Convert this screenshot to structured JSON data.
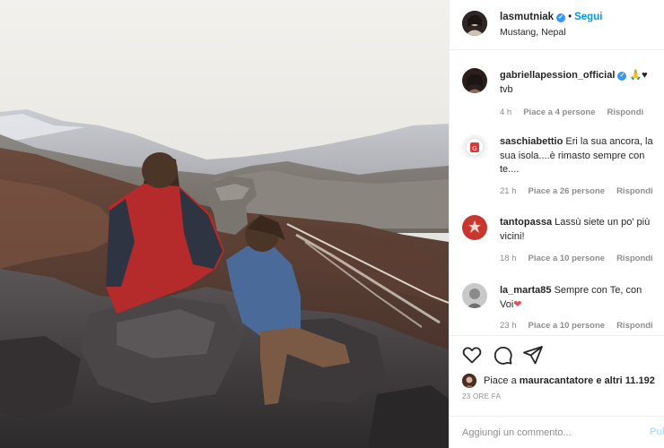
{
  "post": {
    "photo_icon": "photo",
    "header": {
      "username": "lasmutniak",
      "verified_icon": "verified-badge-icon",
      "separator": "•",
      "follow_label": "Segui",
      "location": "Mustang, Nepal"
    },
    "comments": [
      {
        "username": "gabriellapession_official",
        "verified": true,
        "emoji": "🙏♥",
        "text": "tvb",
        "time": "4 h",
        "likes": "Piace a 4 persone",
        "reply_label": "Rispondi",
        "avatar_color": "#2a1f1c"
      },
      {
        "username": "saschiabettio",
        "text": "Eri la sua ancora, la sua isola....è rimasto sempre con te....",
        "time": "21 h",
        "likes": "Piace a 26 persone",
        "reply_label": "Rispondi",
        "avatar_color": "#d93a3a"
      },
      {
        "username": "tantopassa",
        "text": "Lassù siete un po' più vicini!",
        "time": "18 h",
        "likes": "Piace a 10 persone",
        "reply_label": "Rispondi",
        "avatar_color": "#c8372d"
      },
      {
        "username": "la_marta85",
        "text": "Sempre con Te, con Voi",
        "heart": "❤",
        "time": "23 h",
        "likes": "Piace a 10 persone",
        "reply_label": "Rispondi",
        "avatar_color": "#8a8a8a"
      }
    ],
    "actions": {
      "like_icon": "heart-icon",
      "comment_icon": "comment-icon",
      "share_icon": "share-icon"
    },
    "likes": {
      "prefix": "Piace a",
      "user": "mauracantatore",
      "suffix": "e altri 11.192"
    },
    "timeago": "23 ORE FA",
    "add_comment": {
      "placeholder": "Aggiungi un commento...",
      "publish_label": "Pul"
    },
    "colors": {
      "accent": "#0095f6",
      "verified": "#3897f0",
      "heart": "#ed4956",
      "muted": "#8e8e8e"
    }
  }
}
